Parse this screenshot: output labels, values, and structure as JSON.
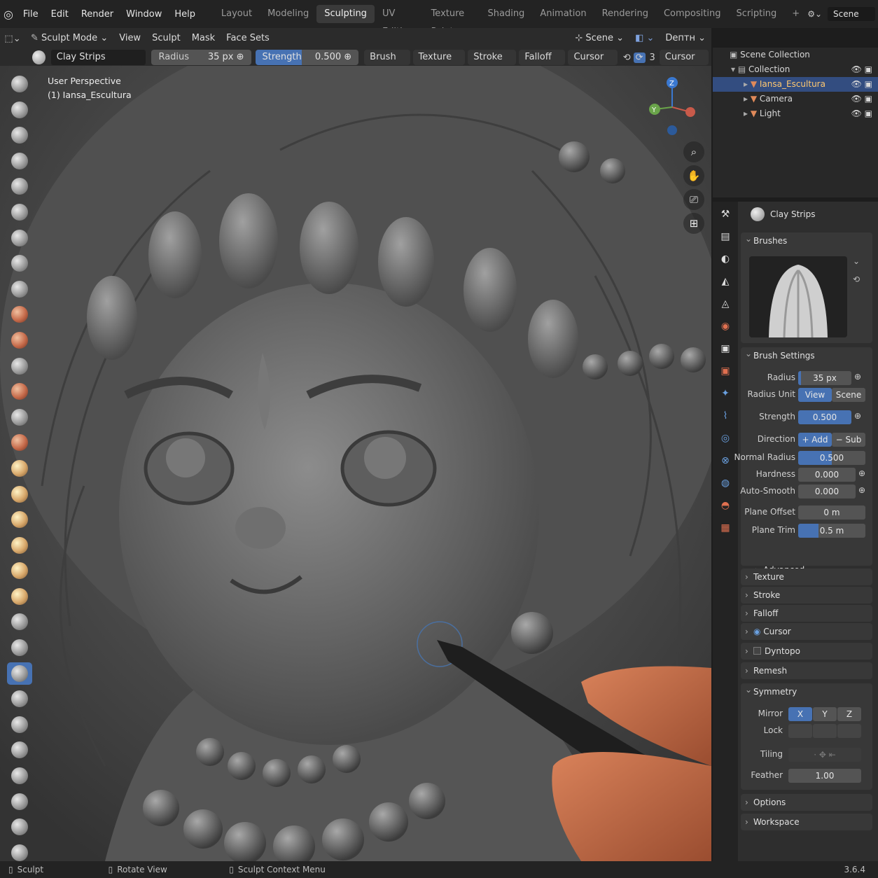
{
  "topbar": {
    "menus": [
      "File",
      "Edit",
      "Render",
      "Window",
      "Help"
    ],
    "workspaces": [
      "Layout",
      "Modeling",
      "Sculpting",
      "UV Editing",
      "Texture Paint",
      "Shading",
      "Animation",
      "Rendering",
      "Compositing",
      "Scripting"
    ],
    "active_workspace": "Sculpting",
    "plus": "+",
    "scene": "Scene"
  },
  "header": {
    "mode": "Sculpt Mode",
    "menus": [
      "View",
      "Sculpt",
      "Mask",
      "Face Sets"
    ],
    "scene_orient": "Scene",
    "snap": "Deптн"
  },
  "toolsettings": {
    "brush_name": "Clay Strips",
    "radius_label": "Radius",
    "radius_value": "35 px",
    "strength_label": "Strength",
    "strength_value": "0.500",
    "dropdowns": [
      "Brush",
      "Texture",
      "Stroke",
      "Falloff",
      "Cursor"
    ],
    "sym_count": "3",
    "cursor2": "Cursor"
  },
  "viewport": {
    "line1": "User Perspective",
    "line2": "(1) Iansa_Escultura",
    "gizmo_z": "Z",
    "gizmo_y": "Y",
    "gizmo_x": "X"
  },
  "outliner": {
    "root": "Scene Collection",
    "collection": "Collection",
    "items": [
      "Iansa_Escultura",
      "Camera",
      "Light"
    ]
  },
  "properties": {
    "brush_name": "Clay Strips",
    "brushes_header": "Brushes",
    "brush_settings_header": "Brush Settings",
    "radius_label": "Radius",
    "radius_value": "35 px",
    "radius_unit_label": "Radius Unit",
    "radius_unit_view": "View",
    "radius_unit_scene": "Scene",
    "strength_label": "Strength",
    "strength_value": "0.500",
    "direction_label": "Direction",
    "direction_add": "+ Add",
    "direction_sub": "− Sub",
    "normal_radius_label": "Normal Radius",
    "normal_radius_value": "0.500",
    "hardness_label": "Hardness",
    "hardness_value": "0.000",
    "autosmooth_label": "Auto-Smooth",
    "autosmooth_value": "0.000",
    "plane_offset_label": "Plane Offset",
    "plane_offset_value": "0 m",
    "plane_trim_label": "Plane Trim",
    "plane_trim_value": "0.5 m",
    "advanced": "Advanced",
    "texture": "Texture",
    "stroke": "Stroke",
    "falloff": "Falloff",
    "cursor": "Cursor",
    "dyntopo": "Dyntopo",
    "remesh": "Remesh",
    "symmetry": "Symmetry",
    "mirror_label": "Mirror",
    "axes": [
      "X",
      "Y",
      "Z"
    ],
    "lock_label": "Lock",
    "tiling_label": "Tiling",
    "feather_label": "Feather",
    "feather_value": "1.00",
    "options": "Options",
    "workspace": "Workspace"
  },
  "status": {
    "sculpt": "Sculpt",
    "rotate": "Rotate View",
    "context": "Sculpt Context Menu",
    "version": "3.6.4"
  },
  "colors": {
    "accent": "#4772b3",
    "selection": "#334d80"
  }
}
